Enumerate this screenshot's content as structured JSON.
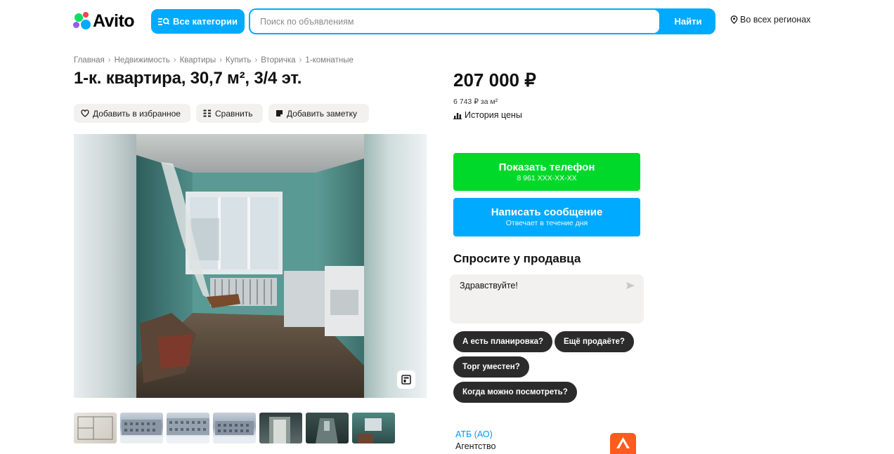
{
  "header": {
    "logo_text": "Avito",
    "categories_label": "Все категории",
    "search_placeholder": "Поиск по объявлениям",
    "search_button": "Найти",
    "region_label": "Во всех регионах"
  },
  "breadcrumb": [
    "Главная",
    "Недвижимость",
    "Квартиры",
    "Купить",
    "Вторичка",
    "1-комнатные"
  ],
  "listing": {
    "title": "1-к. квартира, 30,7 м², 3/4 эт.",
    "actions": {
      "favorite": "Добавить в избранное",
      "compare": "Сравнить",
      "note": "Добавить заметку"
    }
  },
  "price": {
    "value": "207 000 ₽",
    "per_meter": "6 743 ₽ за м²",
    "history_label": "История цены"
  },
  "contact": {
    "phone_label": "Показать телефон",
    "phone_masked": "8 961 XXX-XX-XX",
    "message_label": "Написать сообщение",
    "message_sub": "Отвечает в течение дня"
  },
  "ask": {
    "title": "Спросите у продавца",
    "input_value": "Здравствуйте!",
    "chips": [
      "А есть планировка?",
      "Ещё продаёте?",
      "Торг уместен?",
      "Когда можно посмотреть?"
    ]
  },
  "seller": {
    "name": "АТБ (АО)",
    "type": "Агентство"
  },
  "colors": {
    "accent_blue": "#00aaff",
    "phone_green": "#00d92a",
    "chip_dark": "#2b2b2b",
    "link_blue": "#0099f7"
  },
  "icons": [
    "avito-logo-icon",
    "category-search-icon",
    "location-pin-icon",
    "heart-icon",
    "compare-icon",
    "note-icon",
    "chart-icon",
    "gallery-icon",
    "send-icon"
  ]
}
